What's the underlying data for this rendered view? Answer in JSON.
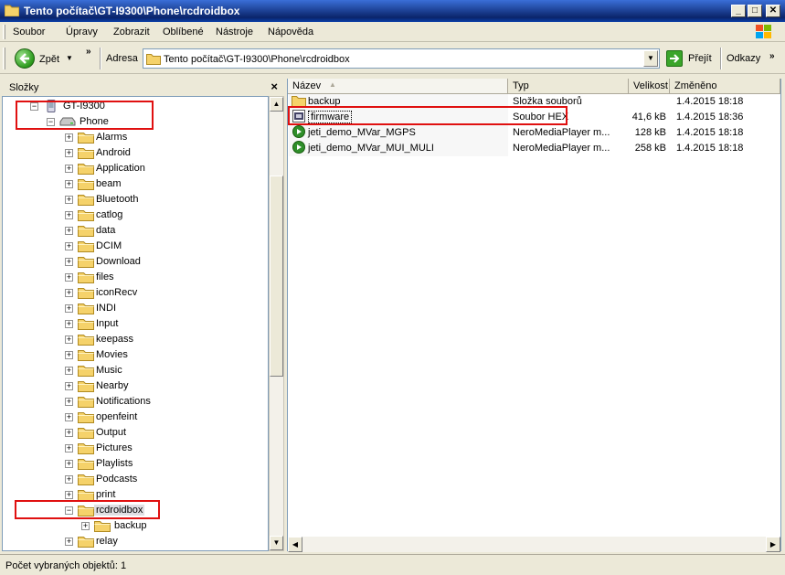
{
  "window": {
    "title": "Tento počítač\\GT-I9300\\Phone\\rcdroidbox"
  },
  "menu": {
    "items": [
      "Soubor",
      "Úpravy",
      "Zobrazit",
      "Oblíbené",
      "Nástroje",
      "Nápověda"
    ]
  },
  "toolbar": {
    "back_label": "Zpět",
    "address_label": "Adresa",
    "address_value": "Tento počítač\\GT-I9300\\Phone\\rcdroidbox",
    "go_label": "Přejít",
    "links_label": "Odkazy"
  },
  "folders_pane": {
    "title": "Složky"
  },
  "tree": {
    "device": "GT-I9300",
    "storage": "Phone",
    "folders": [
      "Alarms",
      "Android",
      "Application",
      "beam",
      "Bluetooth",
      "catlog",
      "data",
      "DCIM",
      "Download",
      "files",
      "iconRecv",
      "INDI",
      "Input",
      "keepass",
      "Movies",
      "Music",
      "Nearby",
      "Notifications",
      "openfeint",
      "Output",
      "Pictures",
      "Playlists",
      "Podcasts",
      "print",
      "rcdroidbox",
      "backup",
      "relay"
    ]
  },
  "columns": {
    "name": "Název",
    "type": "Typ",
    "size": "Velikost",
    "modified": "Změněno"
  },
  "files": [
    {
      "name": "backup",
      "type": "Složka souborů",
      "size": "",
      "modified": "1.4.2015 18:18",
      "icon": "folder-icon"
    },
    {
      "name": "firmware",
      "type": "Soubor HEX",
      "size": "41,6 kB",
      "modified": "1.4.2015 18:36",
      "icon": "hex-file-icon"
    },
    {
      "name": "jeti_demo_MVar_MGPS",
      "type": "NeroMediaPlayer m...",
      "size": "128 kB",
      "modified": "1.4.2015 18:18",
      "icon": "media-file-icon"
    },
    {
      "name": "jeti_demo_MVar_MUI_MULI",
      "type": "NeroMediaPlayer m...",
      "size": "258 kB",
      "modified": "1.4.2015 18:18",
      "icon": "media-file-icon"
    }
  ],
  "status": {
    "text": "Počet vybraných objektů: 1"
  }
}
